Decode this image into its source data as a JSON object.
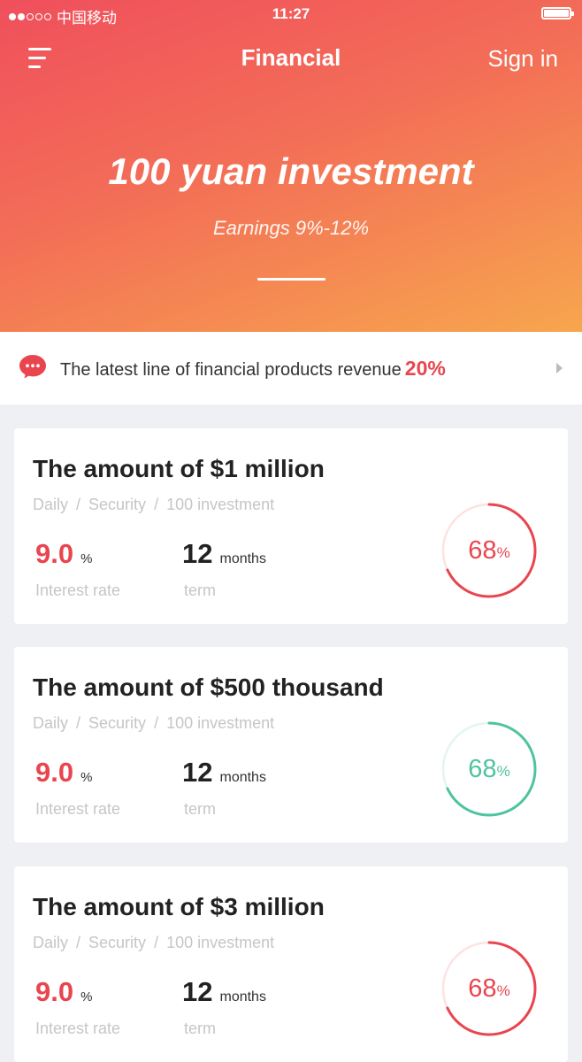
{
  "status_bar": {
    "carrier": "中国移动",
    "time": "11:27"
  },
  "nav": {
    "title": "Financial",
    "sign_in": "Sign in"
  },
  "hero": {
    "title": "100 yuan investment",
    "subtitle": "Earnings 9%-12%"
  },
  "notice": {
    "text": "The latest line of financial products revenue",
    "highlight": "20%"
  },
  "colors": {
    "accent_red": "#e9454f",
    "accent_green": "#4fc3a1"
  },
  "cards": [
    {
      "title": "The amount of $1 million",
      "tags": [
        "Daily",
        "Security",
        "100 investment"
      ],
      "rate_value": "9.0",
      "rate_unit": "%",
      "rate_label": "Interest rate",
      "term_value": "12",
      "term_unit": "months",
      "term_label": "term",
      "progress": 68,
      "progress_text": "68",
      "progress_unit": "%",
      "ring_color": "#e9454f",
      "ring_track": "#fde3e3"
    },
    {
      "title": "The amount of $500 thousand",
      "tags": [
        "Daily",
        "Security",
        "100 investment"
      ],
      "rate_value": "9.0",
      "rate_unit": "%",
      "rate_label": "Interest rate",
      "term_value": "12",
      "term_unit": "months",
      "term_label": "term",
      "progress": 68,
      "progress_text": "68",
      "progress_unit": "%",
      "ring_color": "#4fc3a1",
      "ring_track": "#e2f5ef"
    },
    {
      "title": "The amount of $3 million",
      "tags": [
        "Daily",
        "Security",
        "100 investment"
      ],
      "rate_value": "9.0",
      "rate_unit": "%",
      "rate_label": "Interest rate",
      "term_value": "12",
      "term_unit": "months",
      "term_label": "term",
      "progress": 68,
      "progress_text": "68",
      "progress_unit": "%",
      "ring_color": "#e9454f",
      "ring_track": "#fde3e3"
    }
  ]
}
